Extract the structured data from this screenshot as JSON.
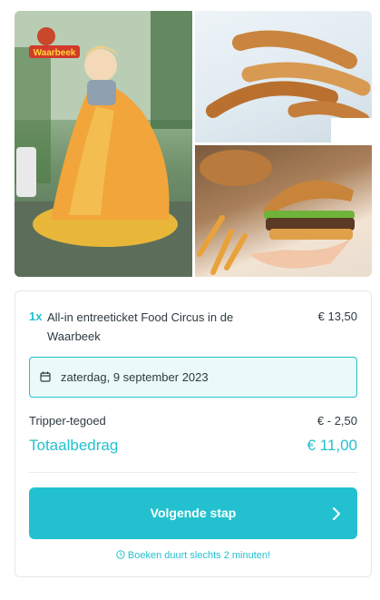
{
  "gallery": {
    "logo_text": "Waarbeek",
    "images": [
      {
        "name": "child-on-boat-ride"
      },
      {
        "name": "churros"
      },
      {
        "name": "burger-and-fries"
      }
    ]
  },
  "order": {
    "quantity": "1x",
    "item_name": "All-in entreeticket Food Circus in de Waarbeek",
    "item_price": "€ 13,50",
    "date": "zaterdag, 9 september 2023",
    "credit_label": "Tripper-tegoed",
    "credit_value": "€ - 2,50",
    "total_label": "Totaalbedrag",
    "total_value": "€ 11,00"
  },
  "cta": {
    "label": "Volgende stap",
    "note": "Boeken duurt slechts 2 minuten!"
  },
  "colors": {
    "accent": "#23c1cf",
    "date_bg": "#eafafa",
    "text": "#2c3a40"
  },
  "icons": {
    "date": "calendar-icon",
    "next": "chevron-right-icon",
    "note": "clock-icon"
  }
}
